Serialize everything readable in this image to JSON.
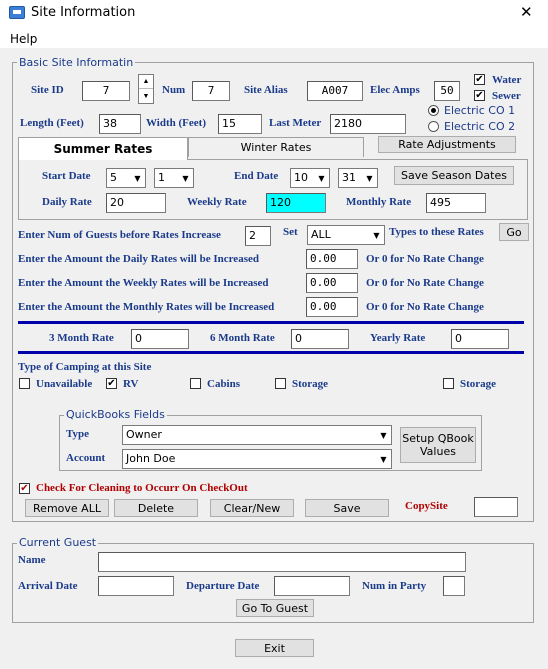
{
  "window": {
    "title": "Site Information",
    "close": "✕"
  },
  "menu": {
    "help": "Help"
  },
  "basic": {
    "legend": "Basic Site Informatin",
    "site_id_label": "Site ID",
    "site_id": "7",
    "num_label": "Num",
    "num": "7",
    "alias_label": "Site Alias",
    "alias": "A007",
    "elec_amps_label": "Elec Amps",
    "elec_amps": "50",
    "water_label": "Water",
    "sewer_label": "Sewer",
    "electric_co1": "Electric CO 1",
    "electric_co2": "Electric CO 2",
    "length_label": "Length (Feet)",
    "length": "38",
    "width_label": "Width (Feet)",
    "width": "15",
    "last_meter_label": "Last Meter",
    "last_meter": "2180"
  },
  "tabs": {
    "summer": "Summer Rates",
    "winter": "Winter Rates",
    "rate_adjustments": "Rate Adjustments"
  },
  "summer": {
    "start_date_label": "Start Date",
    "start_month": "5",
    "start_day": "1",
    "end_date_label": "End Date",
    "end_month": "10",
    "end_day": "31",
    "save_season": "Save Season Dates",
    "daily_label": "Daily Rate",
    "daily": "20",
    "weekly_label": "Weekly Rate",
    "weekly": "120",
    "monthly_label": "Monthly Rate",
    "monthly": "495"
  },
  "increase": {
    "guests_label": "Enter Num of Guests before Rates Increase",
    "guests": "2",
    "set_label": "Set",
    "set_value": "ALL",
    "types_label": "Types to these Rates",
    "go": "Go",
    "daily_label": "Enter the Amount the Daily Rates will be Increased",
    "daily": "0.00",
    "weekly_label": "Enter the Amount the Weekly Rates will be Increased",
    "weekly": "0.00",
    "monthly_label": "Enter the Amount the Monthly Rates will be Increased",
    "monthly": "0.00",
    "or_zero": "Or 0 for No Rate Change"
  },
  "long_rates": {
    "three_month_label": "3 Month Rate",
    "three_month": "0",
    "six_month_label": "6 Month Rate",
    "six_month": "0",
    "yearly_label": "Yearly Rate",
    "yearly": "0"
  },
  "camping": {
    "label": "Type of Camping at this Site",
    "unavailable": "Unavailable",
    "rv": "RV",
    "cabins": "Cabins",
    "storage1": "Storage",
    "storage2": "Storage"
  },
  "quickbooks": {
    "legend": "QuickBooks Fields",
    "type_label": "Type",
    "type_value": "Owner",
    "account_label": "Account",
    "account_value": "John Doe",
    "setup": "Setup QBook Values"
  },
  "cleaning_label": "Check For Cleaning to Occurr On CheckOut",
  "actions": {
    "remove_all": "Remove ALL",
    "delete": "Delete",
    "clear_new": "Clear/New",
    "save": "Save",
    "copysite_label": "CopySite",
    "copysite": ""
  },
  "guest": {
    "legend": "Current Guest",
    "name_label": "Name",
    "name": "",
    "arrival_label": "Arrival Date",
    "arrival": "",
    "departure_label": "Departure Date",
    "departure": "",
    "party_label": "Num in Party",
    "party": "",
    "go_to_guest": "Go To Guest"
  },
  "exit": "Exit"
}
